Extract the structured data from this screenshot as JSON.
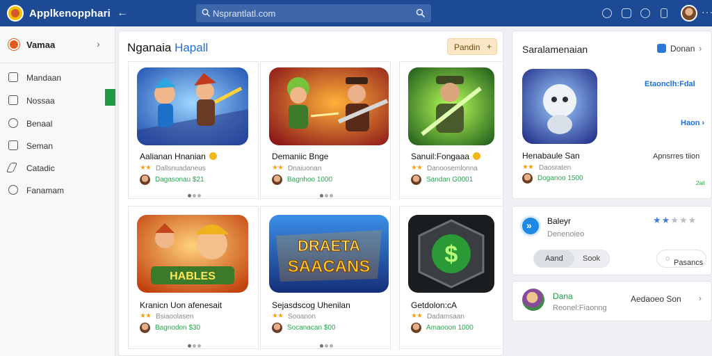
{
  "header": {
    "app_title": "Applkenopphari",
    "search_placeholder": "Nsprantlatl.com",
    "colors": {
      "bar": "#1c4a94",
      "search": "#3d66ab"
    }
  },
  "sidebar": {
    "head_label": "Vamaa",
    "items": [
      {
        "label": "Mandaan",
        "icon": "grid-icon"
      },
      {
        "label": "Nossaa",
        "icon": "tray-icon"
      },
      {
        "label": "Benaal",
        "icon": "clock-icon"
      },
      {
        "label": "Seman",
        "icon": "save-icon"
      },
      {
        "label": "Catadic",
        "icon": "pencil-icon"
      },
      {
        "label": "Fanamam",
        "icon": "people-icon"
      }
    ],
    "active_color": "#1f9a42"
  },
  "main": {
    "title_plain": "Nganaia ",
    "title_accent": "Hapall",
    "button_label": "Pandin",
    "cards": [
      {
        "name": "Aalianan Hnanian",
        "sub": "Dallsnuadaneus",
        "price": "Dagasonau $21"
      },
      {
        "name": "Demaniic Bnge",
        "sub": "Dnaiuonan",
        "price": "Bagnhoo 1000"
      },
      {
        "name": "Sanuil:Fongaaa",
        "sub": "Danoosemlonna",
        "price": "Sandan G0001"
      },
      {
        "name": "Kranicn Uon afenesait",
        "sub": "Bsiaoolasen",
        "price": "Bagnodon $30"
      },
      {
        "name": "Sejasdscog Uhenilan",
        "sub": "Sooanon",
        "price": "Socanacan $00"
      },
      {
        "name": "Getdolon:cA",
        "sub": "Dadamsaan",
        "price": "Amaooon 1000"
      }
    ]
  },
  "right_panel": {
    "title": "Saralamenaian",
    "link": "Donan",
    "side1": "Etaonclh:Fdal",
    "side2": "Haon",
    "name": "Henabaule San",
    "side3": "Apnsrres tiion",
    "sub": "Daosraten",
    "price": "Doganoo 1500",
    "tiny": "2ait"
  },
  "right_panel_2": {
    "title": "Baleyr",
    "sub": "Denenoieo",
    "rating": 2,
    "seg_a": "Aand",
    "seg_b": "Sook",
    "pill": "Pasancs"
  },
  "right_panel_3": {
    "title": "Dana",
    "sub": "Reonel:Fiaonng",
    "right_text": "Aedaoeo Son"
  }
}
